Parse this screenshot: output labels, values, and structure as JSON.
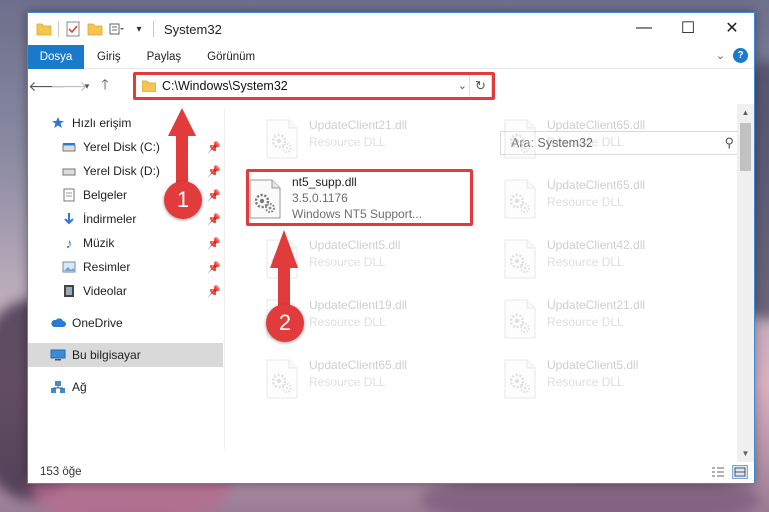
{
  "window": {
    "title": "System32",
    "controls": {
      "minimize": "—",
      "maximize": "☐",
      "close": "✕"
    }
  },
  "ribbon": {
    "tabs": [
      {
        "label": "Dosya",
        "active": true
      },
      {
        "label": "Giriş"
      },
      {
        "label": "Paylaş"
      },
      {
        "label": "Görünüm"
      }
    ],
    "help": "?"
  },
  "nav": {
    "address_path": "C:\\Windows\\System32",
    "search_placeholder": "Ara: System32"
  },
  "sidebar": {
    "items": [
      {
        "label": "Hızlı erişim",
        "icon": "star-icon"
      },
      {
        "label": "Yerel Disk (C:)",
        "icon": "drive-icon",
        "pinned": true
      },
      {
        "label": "Yerel Disk (D:)",
        "icon": "drive-icon",
        "pinned": true
      },
      {
        "label": "Belgeler",
        "icon": "document-icon",
        "pinned": true
      },
      {
        "label": "İndirmeler",
        "icon": "download-icon",
        "pinned": true
      },
      {
        "label": "Müzik",
        "icon": "music-icon",
        "pinned": true
      },
      {
        "label": "Resimler",
        "icon": "pictures-icon",
        "pinned": true
      },
      {
        "label": "Videolar",
        "icon": "video-icon",
        "pinned": true
      },
      {
        "label": "OneDrive",
        "icon": "cloud-icon"
      },
      {
        "label": "Bu bilgisayar",
        "icon": "computer-icon",
        "selected": true
      },
      {
        "label": "Ağ",
        "icon": "network-icon"
      }
    ]
  },
  "files": [
    {
      "name": "UpdateClient21.dll",
      "desc": "Resource DLL",
      "faded": true
    },
    {
      "name": "UpdateClient65.dll",
      "desc": "Resource DLL",
      "faded": true
    },
    {
      "name": "nt5_supp.dll",
      "version": "3.5.0.1176",
      "desc": "Windows NT5 Support...",
      "faded": false
    },
    {
      "name": "UpdateClient65.dll",
      "desc": "Resource DLL",
      "faded": true
    },
    {
      "name": "UpdateClient5.dll",
      "desc": "Resource DLL",
      "faded": true
    },
    {
      "name": "UpdateClient42.dll",
      "desc": "Resource DLL",
      "faded": true
    },
    {
      "name": "UpdateClient19.dll",
      "desc": "Resource DLL",
      "faded": true
    },
    {
      "name": "UpdateClient21.dll",
      "desc": "Resource DLL",
      "faded": true
    },
    {
      "name": "UpdateClient65.dll",
      "desc": "Resource DLL",
      "faded": true
    },
    {
      "name": "UpdateClient5.dll",
      "desc": "Resource DLL",
      "faded": true
    }
  ],
  "status": {
    "item_count": "153 öğe"
  },
  "annotations": {
    "step1": "1",
    "step2": "2"
  },
  "colors": {
    "accent": "#1979ca",
    "highlight": "#e23b3b"
  }
}
